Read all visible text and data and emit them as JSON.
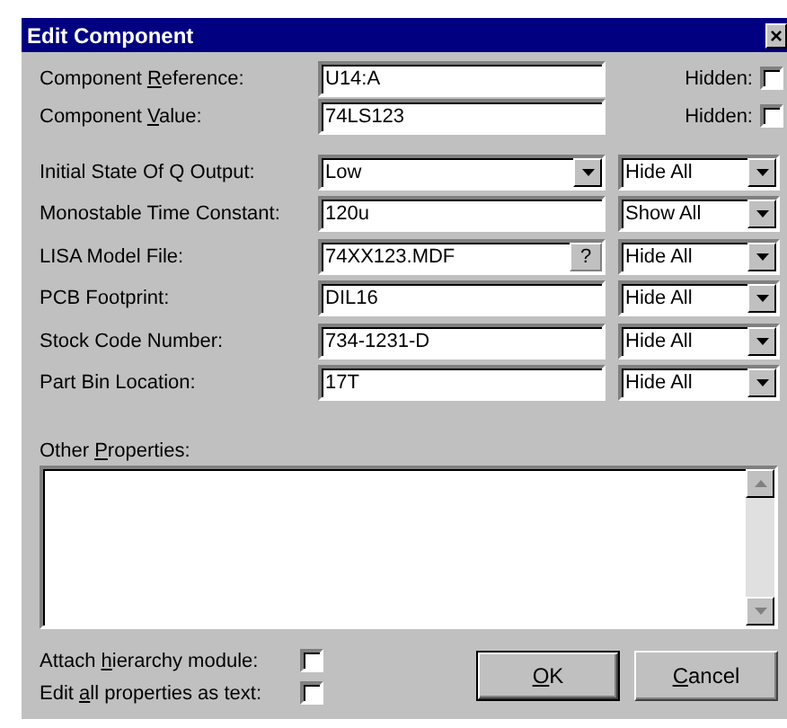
{
  "window": {
    "title": "Edit Component",
    "close": "×"
  },
  "identity": [
    {
      "label": [
        {
          "text": "Component ",
          "underlined": false
        },
        {
          "text": "R",
          "underlined": true
        },
        {
          "text": "eference:",
          "underlined": false
        }
      ],
      "value": "U14:A",
      "hidden_label": "Hidden:",
      "hidden": false
    },
    {
      "label": [
        {
          "text": "Component ",
          "underlined": false
        },
        {
          "text": "V",
          "underlined": true
        },
        {
          "text": "alue:",
          "underlined": false
        }
      ],
      "value": "74LS123",
      "hidden_label": "Hidden:",
      "hidden": false
    }
  ],
  "properties": [
    {
      "kind": "dropdown",
      "label": "Initial State Of Q Output:",
      "value": "Low",
      "visibility": "Hide All"
    },
    {
      "kind": "text",
      "label": "Monostable Time Constant:",
      "value": "120u",
      "visibility": "Show All"
    },
    {
      "kind": "file",
      "label": "LISA Model File:",
      "value": "74XX123.MDF",
      "browse": "?",
      "visibility": "Hide All"
    },
    {
      "kind": "text",
      "label": "PCB Footprint:",
      "value": "DIL16",
      "visibility": "Hide All"
    },
    {
      "kind": "text",
      "label": "Stock Code Number:",
      "value": "734-1231-D",
      "visibility": "Hide All"
    },
    {
      "kind": "text",
      "label": "Part Bin Location:",
      "value": "17T",
      "visibility": "Hide All"
    }
  ],
  "other_properties": {
    "label": [
      {
        "text": "Other ",
        "underlined": false
      },
      {
        "text": "P",
        "underlined": true
      },
      {
        "text": "roperties:",
        "underlined": false
      }
    ]
  },
  "options": [
    {
      "label": [
        {
          "text": "Attach ",
          "underlined": false
        },
        {
          "text": "h",
          "underlined": true
        },
        {
          "text": "ierarchy module:",
          "underlined": false
        }
      ],
      "checked": false
    },
    {
      "label": [
        {
          "text": "Edit ",
          "underlined": false
        },
        {
          "text": "a",
          "underlined": true
        },
        {
          "text": "ll properties as text:",
          "underlined": false
        }
      ],
      "checked": false
    }
  ],
  "buttons": [
    {
      "label": [
        {
          "text": "O",
          "underlined": true
        },
        {
          "text": "K",
          "underlined": false
        }
      ],
      "default": true
    },
    {
      "label": [
        {
          "text": "C",
          "underlined": true
        },
        {
          "text": "ancel",
          "underlined": false
        }
      ],
      "default": false
    }
  ]
}
